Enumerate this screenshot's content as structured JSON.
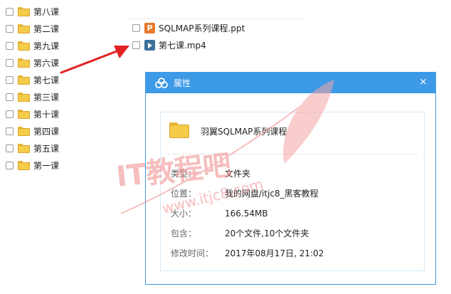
{
  "folders": [
    {
      "label": "第八课"
    },
    {
      "label": "第二课"
    },
    {
      "label": "第九课"
    },
    {
      "label": "第六课"
    },
    {
      "label": "第七课"
    },
    {
      "label": "第三课"
    },
    {
      "label": "第十课"
    },
    {
      "label": "第四课"
    },
    {
      "label": "第五课"
    },
    {
      "label": "第一课"
    }
  ],
  "files": [
    {
      "label": "SQLMAP系列课程.ppt",
      "icon": "ppt-file-icon",
      "icon_letter": "P"
    },
    {
      "label": "第七课.mp4",
      "icon": "video-file-icon"
    }
  ],
  "dialog": {
    "title": "属性",
    "close_glyph": "×",
    "folder_name": "羽翼SQLMAP系列课程",
    "props": [
      {
        "key": "类型：",
        "value": "文件夹"
      },
      {
        "key": "位置：",
        "value": "我的网盘/itjc8_黑客教程"
      },
      {
        "key": "大小：",
        "value": "166.54MB"
      },
      {
        "key": "包含：",
        "value": "20个文件,10个文件夹"
      },
      {
        "key": "修改时间：",
        "value": "2017年08月17日, 21:02"
      }
    ]
  },
  "watermark": {
    "logo_text": "IT教程吧",
    "url": "www.itjc8.com"
  },
  "colors": {
    "accent": "#3d9ae6",
    "arrow": "#e22222",
    "folder": "#f5cb4a",
    "watermark": "#f08a8a"
  }
}
